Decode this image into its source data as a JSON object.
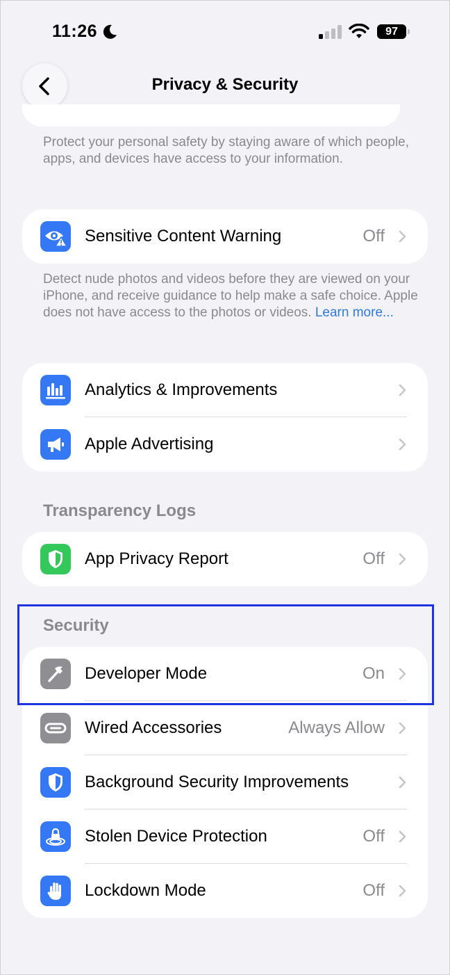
{
  "status_bar": {
    "time": "11:26",
    "battery": "97"
  },
  "nav": {
    "title": "Privacy & Security"
  },
  "safety_footnote": "Protect your personal safety by staying aware of which people, apps, and devices have access to your information.",
  "sensitive": {
    "label": "Sensitive Content Warning",
    "value": "Off",
    "footnote": "Detect nude photos and videos before they are viewed on your iPhone, and receive guidance to help make a safe choice. Apple does not have access to the photos or videos.",
    "learn_more": "Learn more..."
  },
  "analytics_group": [
    {
      "label": "Analytics & Improvements",
      "icon": "bar-chart-icon"
    },
    {
      "label": "Apple Advertising",
      "icon": "megaphone-icon"
    }
  ],
  "transparency": {
    "header": "Transparency Logs",
    "row": {
      "label": "App Privacy Report",
      "value": "Off",
      "icon": "shield-icon"
    }
  },
  "security": {
    "header": "Security",
    "rows": [
      {
        "label": "Developer Mode",
        "value": "On",
        "icon": "hammer-icon"
      },
      {
        "label": "Wired Accessories",
        "value": "Always Allow",
        "icon": "cable-icon"
      },
      {
        "label": "Background Security Improvements",
        "value": "",
        "icon": "shield-icon"
      },
      {
        "label": "Stolen Device Protection",
        "value": "Off",
        "icon": "lock-icon"
      },
      {
        "label": "Lockdown Mode",
        "value": "Off",
        "icon": "hand-icon"
      }
    ]
  },
  "colors": {
    "accent_blue": "#3478f6",
    "link": "#2f7ae0",
    "highlight_box": "#1f33e0",
    "green": "#34c759",
    "gray_icon": "#8e8e93"
  }
}
